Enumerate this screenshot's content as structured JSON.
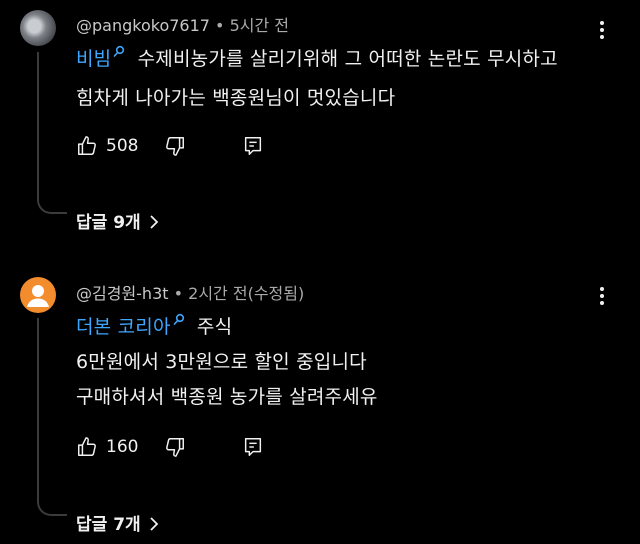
{
  "comments": [
    {
      "handle": "@pangkoko7617",
      "separator": "•",
      "time": "5시간 전",
      "tag": "비빔",
      "line1_rest": "수제비농가를 살리기위해 그 어떠한 논란도 무시하고",
      "line2": "힘차게 나아가는 백종원님이 멋있습니다",
      "likes": "508",
      "replies_label": "답글 9개"
    },
    {
      "handle": "@김경원-h3t",
      "separator": "•",
      "time": "2시간 전(수정됨)",
      "tag": "더본 코리아",
      "line1_rest": "주식",
      "line2": "6만원에서 3만원으로 할인 중입니다",
      "line3": "구매하셔서 백종원 농가를 살려주세유",
      "likes": "160",
      "replies_label": "답글 7개"
    }
  ],
  "icons": {
    "like": "thumbs-up-icon",
    "dislike": "thumbs-down-icon",
    "reply": "reply-comment-icon",
    "more": "more-vertical-icon",
    "search": "search-icon",
    "expand": "chevron-right-icon"
  },
  "colors": {
    "background": "#000000",
    "text": "#f1f1f1",
    "meta": "#aaaaaa",
    "link": "#3ea6ff",
    "avatar_default": "#f28c2c"
  }
}
